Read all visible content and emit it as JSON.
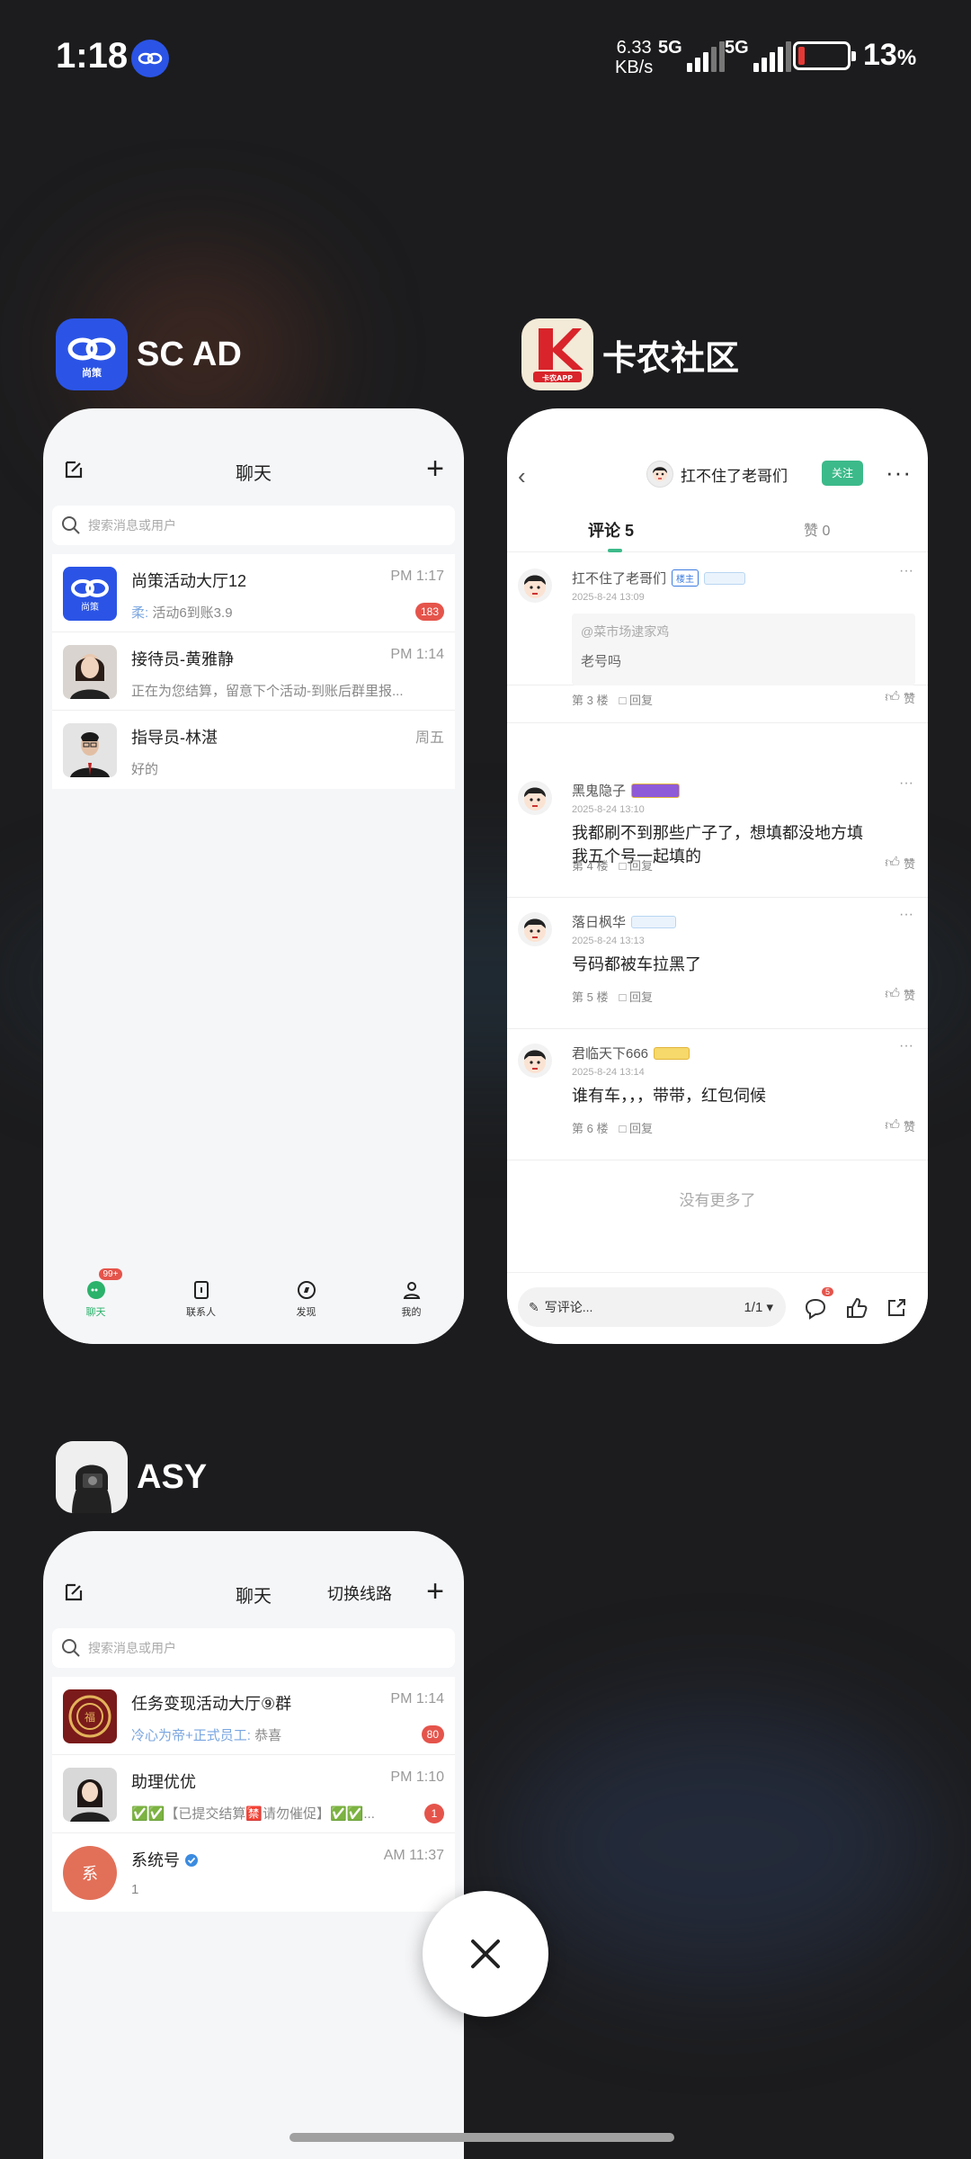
{
  "status": {
    "time": "1:18",
    "net_speed_value": "6.33",
    "net_speed_unit": "KB/s",
    "sim1": "5G",
    "sim2": "5G",
    "battery": "13",
    "battery_unit": "%",
    "battery_level": 0.13,
    "battery_color": "#e53935"
  },
  "apps": {
    "scad": {
      "label": "SC AD",
      "icon_color": "#2b54e6",
      "icon_text": "尚策",
      "header_title": "聊天",
      "search_placeholder": "搜索消息或用户",
      "chats": [
        {
          "name": "尚策活动大厅12",
          "time": "PM 1:17",
          "preview_prefix": "柔:",
          "preview": "活动6到账3.9",
          "badge": "183"
        },
        {
          "name": "接待员-黄雅静",
          "time": "PM 1:14",
          "preview": "正在为您结算，留意下个活动-到账后群里报..."
        },
        {
          "name": "指导员-林湛",
          "time": "周五",
          "preview": "好的"
        }
      ],
      "tabs": [
        {
          "label": "聊天",
          "badge": "99+"
        },
        {
          "label": "联系人"
        },
        {
          "label": "发现"
        },
        {
          "label": "我的"
        }
      ]
    },
    "kanong": {
      "label": "卡农社区",
      "icon_text": "卡农APP",
      "author": "扛不住了老哥们",
      "follow": "关注",
      "tab_comments": "评论 5",
      "tab_likes": "赞 0",
      "comments": [
        {
          "name": "扛不住了老哥们",
          "tag": "楼主",
          "date": "2025-8-24 13:09",
          "quote_name": "@菜市场逮家鸡",
          "quote_text": "老号吗",
          "text": "我五个号一起填的",
          "floor": "第 3 楼",
          "reply": "回复",
          "like": "赞"
        },
        {
          "name": "黑鬼隐子",
          "date": "2025-8-24 13:10",
          "text": "我都刷不到那些广子了，想填都没地方填",
          "floor": "第 4 楼",
          "reply": "回复",
          "like": "赞"
        },
        {
          "name": "落日枫华",
          "date": "2025-8-24 13:13",
          "text": "号码都被车拉黑了",
          "floor": "第 5 楼",
          "reply": "回复",
          "like": "赞"
        },
        {
          "name": "君临天下666",
          "date": "2025-8-24 13:14",
          "text": "谁有车，，，带带，红包伺候",
          "floor": "第 6 楼",
          "reply": "回复",
          "like": "赞"
        }
      ],
      "no_more": "没有更多了",
      "write_placeholder": "写评论...",
      "page": "1/1",
      "comment_count_badge": "5",
      "accent": "#3cba8a"
    },
    "asy": {
      "label": "ASY",
      "header_title": "聊天",
      "switch_label": "切换线路",
      "search_placeholder": "搜索消息或用户",
      "chats": [
        {
          "name": "任务变现活动大厅⑨群",
          "time": "PM 1:14",
          "preview_prefix": "冷心为帝+正式员工:",
          "preview": "恭喜",
          "badge": "80"
        },
        {
          "name": "助理优优",
          "time": "PM 1:10",
          "preview": "✅✅【已提交结算🈲请勿催促】✅✅...",
          "badge": "1"
        },
        {
          "name": "系统号",
          "time": "AM 11:37",
          "preview": "1",
          "avatar_text": "系"
        }
      ]
    }
  }
}
